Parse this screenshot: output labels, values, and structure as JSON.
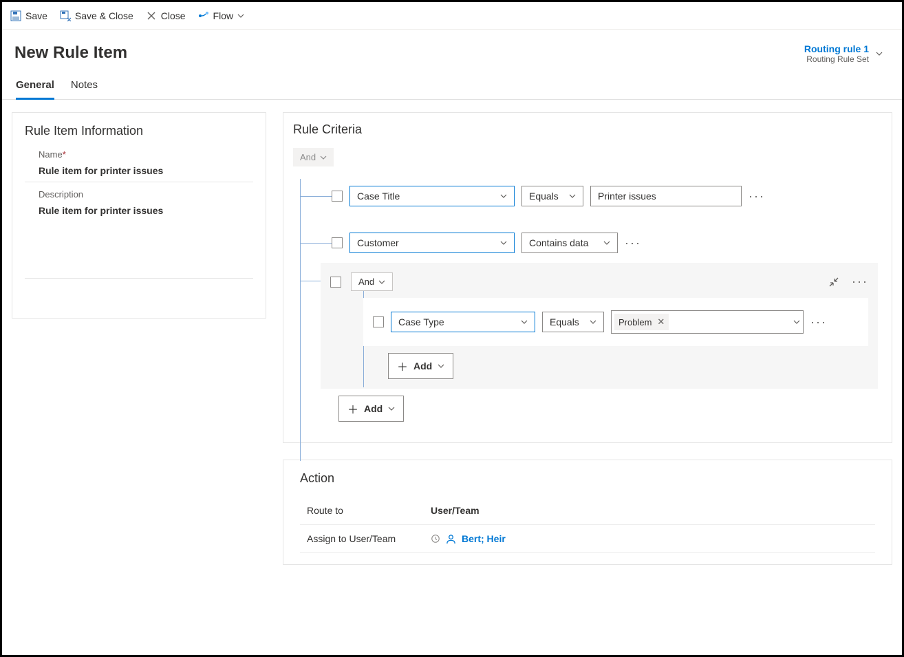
{
  "toolbar": {
    "save": "Save",
    "saveClose": "Save & Close",
    "close": "Close",
    "flow": "Flow"
  },
  "header": {
    "title": "New Rule Item",
    "routingLink": "Routing rule 1",
    "routingSub": "Routing Rule Set"
  },
  "tabs": {
    "general": "General",
    "notes": "Notes"
  },
  "info": {
    "cardTitle": "Rule Item Information",
    "nameLabel": "Name",
    "nameValue": "Rule item for printer issues",
    "descLabel": "Description",
    "descValue": "Rule item for printer issues"
  },
  "criteria": {
    "title": "Rule Criteria",
    "rootOp": "And",
    "row1": {
      "field": "Case Title",
      "op": "Equals",
      "value": "Printer issues"
    },
    "row2": {
      "field": "Customer",
      "op": "Contains data"
    },
    "nested": {
      "op": "And",
      "row": {
        "field": "Case Type",
        "op": "Equals",
        "value": "Problem"
      },
      "add": "Add"
    },
    "add": "Add"
  },
  "action": {
    "title": "Action",
    "routeToLabel": "Route to",
    "routeToValue": "User/Team",
    "assignLabel": "Assign to User/Team",
    "assignValue": "Bert; Heir"
  }
}
